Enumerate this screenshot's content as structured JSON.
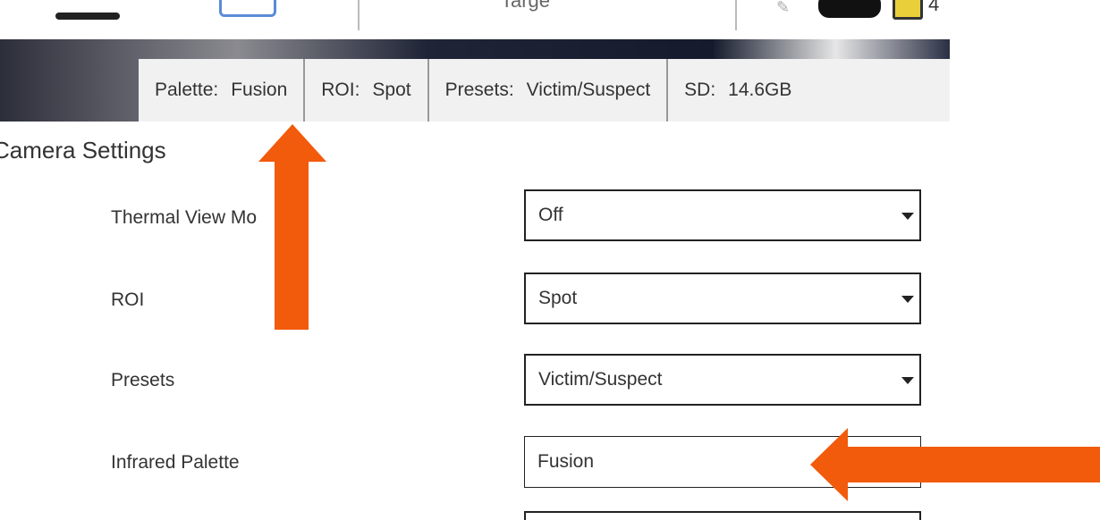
{
  "topbar": {
    "title": "Targe",
    "battery_text": "4"
  },
  "status": {
    "palette_key": "Palette:",
    "palette_val": "Fusion",
    "roi_key": "ROI:",
    "roi_val": "Spot",
    "presets_key": "Presets:",
    "presets_val": "Victim/Suspect",
    "sd_key": "SD:",
    "sd_val": "14.6GB"
  },
  "section_title": "Camera Settings",
  "settings": [
    {
      "label": "Thermal View Mo",
      "value": "Off"
    },
    {
      "label": "ROI",
      "value": "Spot"
    },
    {
      "label": "Presets",
      "value": "Victim/Suspect"
    },
    {
      "label": "Infrared Palette",
      "value": "Fusion"
    }
  ],
  "colors": {
    "arrow": "#f25a0c"
  },
  "icons": [
    "menu-icon",
    "monitor-icon",
    "pencil-icon",
    "toggle-icon",
    "battery-icon",
    "chevron-down-icon"
  ]
}
